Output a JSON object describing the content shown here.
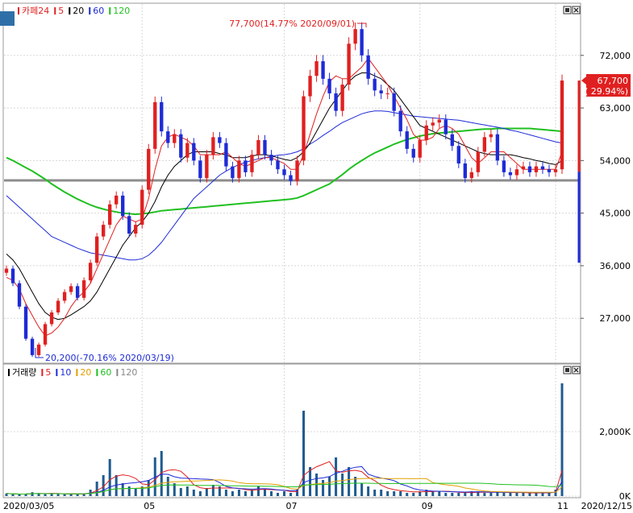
{
  "chart_data": [
    {
      "type": "candlestick",
      "legend": {
        "items": [
          {
            "label": "카페24",
            "color": "#e02020"
          },
          {
            "label": "5",
            "color": "#e02020"
          },
          {
            "label": "20",
            "color": "#000000"
          },
          {
            "label": "60",
            "color": "#1e2bd6"
          },
          {
            "label": "120",
            "color": "#20c020"
          }
        ]
      },
      "y_ticks": [
        "72,000",
        "63,000",
        "54,000",
        "45,000",
        "36,000",
        "27,000"
      ],
      "ylim": [
        20000,
        79000
      ],
      "x_ticks": [
        "2020/03/05",
        "05",
        "07",
        "09",
        "11",
        "2020/12/15"
      ],
      "annotations": {
        "high": "77,700(14.77% 2020/09/01)",
        "low": "20,200(-70.16% 2020/03/19)",
        "last_price": "67,700",
        "last_change": "( 29.94%)"
      },
      "reference_line": 50600,
      "series": {
        "close": [
          35500,
          33000,
          29000,
          23500,
          20700,
          22500,
          26000,
          28000,
          30000,
          31500,
          32500,
          30500,
          33500,
          36500,
          41000,
          43000,
          46500,
          48000,
          44500,
          41500,
          43000,
          49000,
          56000,
          64000,
          59000,
          57000,
          58500,
          54500,
          57000,
          54000,
          51000,
          55000,
          58000,
          57000,
          53000,
          51000,
          54000,
          52000,
          55000,
          57500,
          55000,
          54000,
          52500,
          51500,
          50500,
          54000,
          65000,
          68500,
          71000,
          68000,
          65500,
          62500,
          67000,
          74000,
          76500,
          72000,
          68000,
          66000,
          65500,
          65500,
          62500,
          59000,
          56000,
          54500,
          57500,
          60000,
          60500,
          61000,
          58500,
          56500,
          53500,
          51000,
          52000,
          55500,
          58000,
          58500,
          54000,
          52000,
          51500,
          52500,
          53000,
          52000,
          53000,
          52500,
          52000,
          52500,
          67700
        ],
        "ma5": [
          34000,
          33500,
          32000,
          29500,
          27500,
          25500,
          24000,
          24500,
          25500,
          27000,
          29000,
          30500,
          31500,
          33000,
          35500,
          38000,
          40500,
          43000,
          44500,
          44000,
          43500,
          44000,
          47500,
          52500,
          56500,
          58000,
          58500,
          58000,
          57500,
          56500,
          55000,
          55000,
          55000,
          55000,
          55500,
          54500,
          53500,
          53000,
          53500,
          54000,
          54500,
          54500,
          54000,
          53500,
          52500,
          52500,
          55000,
          58500,
          62000,
          65000,
          67500,
          68500,
          68000,
          68000,
          69000,
          70000,
          71500,
          70000,
          68500,
          67000,
          65000,
          63000,
          61000,
          58500,
          57500,
          57500,
          58000,
          59500,
          60000,
          59500,
          58500,
          56500,
          54500,
          53500,
          54500,
          55500,
          55500,
          55500,
          54500,
          53500,
          52500,
          52500,
          52500,
          52500,
          52500,
          52500,
          55500
        ],
        "ma20": [
          38000,
          37000,
          35500,
          33500,
          31500,
          29500,
          28000,
          27200,
          26800,
          27000,
          27600,
          28300,
          29000,
          30000,
          31500,
          33500,
          35500,
          37500,
          39500,
          41000,
          42500,
          43500,
          45000,
          47000,
          49500,
          51500,
          53000,
          54000,
          55000,
          55500,
          55500,
          55500,
          55500,
          55200,
          55000,
          54500,
          54500,
          54500,
          54800,
          55000,
          55000,
          54800,
          54500,
          54200,
          54000,
          54500,
          55500,
          57000,
          59000,
          61000,
          63000,
          64500,
          66000,
          67500,
          68500,
          69000,
          69000,
          68500,
          68000,
          67000,
          66000,
          64500,
          63000,
          61500,
          60000,
          59500,
          59000,
          58500,
          58000,
          57500,
          57000,
          56500,
          56000,
          55500,
          55200,
          55000,
          55000,
          55000,
          55000,
          54800,
          54500,
          54300,
          54000,
          53800,
          53500,
          53300,
          54000
        ],
        "ma60": [
          48000,
          47000,
          46000,
          45000,
          44000,
          43000,
          42000,
          41000,
          40500,
          40000,
          39500,
          39000,
          38600,
          38200,
          38000,
          37800,
          37600,
          37400,
          37200,
          37000,
          37000,
          37200,
          37800,
          38800,
          40000,
          41500,
          43000,
          44500,
          46000,
          47500,
          48500,
          49500,
          50500,
          51500,
          52200,
          52800,
          53300,
          53700,
          54000,
          54300,
          54500,
          54700,
          54900,
          55000,
          55200,
          55500,
          56000,
          56800,
          57500,
          58300,
          59000,
          59800,
          60500,
          61000,
          61500,
          62000,
          62300,
          62500,
          62500,
          62400,
          62200,
          62000,
          61800,
          61600,
          61500,
          61400,
          61300,
          61200,
          61100,
          61000,
          60900,
          60700,
          60500,
          60300,
          60100,
          59900,
          59700,
          59500,
          59200,
          59000,
          58700,
          58400,
          58100,
          57800,
          57500,
          57200,
          57000
        ],
        "ma120": [
          54500,
          54000,
          53400,
          52800,
          52200,
          51500,
          50800,
          50000,
          49300,
          48600,
          48000,
          47400,
          46900,
          46400,
          46000,
          45700,
          45400,
          45200,
          45000,
          44900,
          44800,
          44900,
          45000,
          45200,
          45400,
          45500,
          45600,
          45700,
          45800,
          45900,
          46000,
          46100,
          46200,
          46300,
          46400,
          46500,
          46600,
          46700,
          46800,
          46900,
          47000,
          47100,
          47200,
          47300,
          47400,
          47600,
          48000,
          48500,
          49000,
          49500,
          50000,
          50800,
          51600,
          52500,
          53300,
          54000,
          54700,
          55300,
          55800,
          56300,
          56800,
          57200,
          57600,
          57900,
          58200,
          58400,
          58600,
          58700,
          58800,
          58900,
          59000,
          59100,
          59200,
          59300,
          59400,
          59400,
          59500,
          59500,
          59500,
          59500,
          59500,
          59500,
          59400,
          59300,
          59200,
          59100,
          59000
        ]
      }
    },
    {
      "type": "bar",
      "legend": {
        "items": [
          {
            "label": "거래량",
            "color": "#000000"
          },
          {
            "label": "5",
            "color": "#e02020"
          },
          {
            "label": "10",
            "color": "#1e2bd6"
          },
          {
            "label": "20",
            "color": "#e0a000"
          },
          {
            "label": "60",
            "color": "#20c020"
          },
          {
            "label": "120",
            "color": "#888888"
          }
        ]
      },
      "y_ticks": [
        "2,000K",
        "0K"
      ],
      "ylim": [
        0,
        3700
      ],
      "values": [
        80,
        60,
        50,
        70,
        120,
        90,
        60,
        80,
        60,
        50,
        70,
        60,
        80,
        200,
        450,
        650,
        1150,
        650,
        400,
        300,
        250,
        300,
        500,
        1200,
        1400,
        600,
        400,
        250,
        300,
        200,
        150,
        250,
        350,
        300,
        200,
        150,
        200,
        150,
        200,
        300,
        200,
        150,
        100,
        150,
        100,
        200,
        2650,
        900,
        700,
        500,
        600,
        1200,
        700,
        900,
        600,
        400,
        300,
        200,
        200,
        150,
        150,
        150,
        100,
        100,
        150,
        200,
        150,
        150,
        100,
        100,
        100,
        100,
        150,
        150,
        100,
        100,
        150,
        100,
        100,
        100,
        100,
        100,
        100,
        100,
        100,
        200,
        3500
      ]
    }
  ]
}
